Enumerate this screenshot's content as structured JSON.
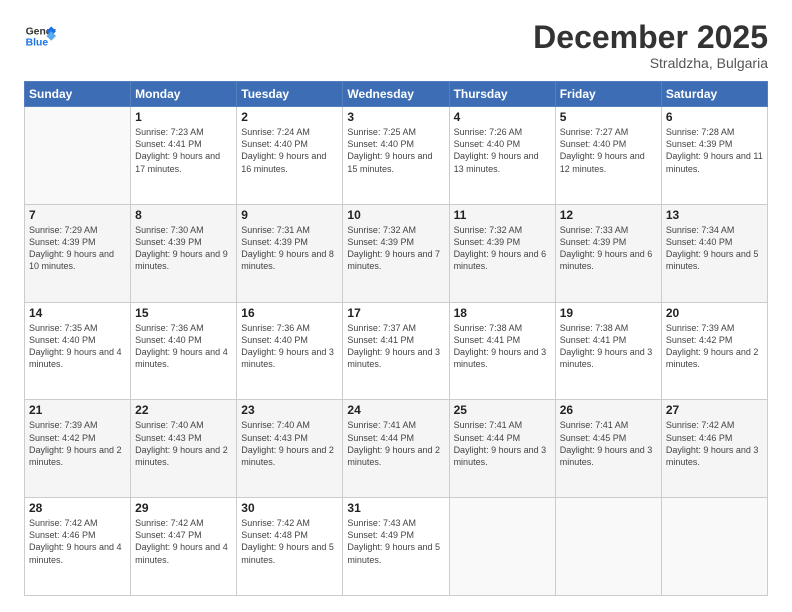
{
  "logo": {
    "line1": "General",
    "line2": "Blue"
  },
  "title": "December 2025",
  "location": "Straldzha, Bulgaria",
  "headers": [
    "Sunday",
    "Monday",
    "Tuesday",
    "Wednesday",
    "Thursday",
    "Friday",
    "Saturday"
  ],
  "weeks": [
    [
      {
        "day": "",
        "sunrise": "",
        "sunset": "",
        "daylight": ""
      },
      {
        "day": "1",
        "sunrise": "Sunrise: 7:23 AM",
        "sunset": "Sunset: 4:41 PM",
        "daylight": "Daylight: 9 hours and 17 minutes."
      },
      {
        "day": "2",
        "sunrise": "Sunrise: 7:24 AM",
        "sunset": "Sunset: 4:40 PM",
        "daylight": "Daylight: 9 hours and 16 minutes."
      },
      {
        "day": "3",
        "sunrise": "Sunrise: 7:25 AM",
        "sunset": "Sunset: 4:40 PM",
        "daylight": "Daylight: 9 hours and 15 minutes."
      },
      {
        "day": "4",
        "sunrise": "Sunrise: 7:26 AM",
        "sunset": "Sunset: 4:40 PM",
        "daylight": "Daylight: 9 hours and 13 minutes."
      },
      {
        "day": "5",
        "sunrise": "Sunrise: 7:27 AM",
        "sunset": "Sunset: 4:40 PM",
        "daylight": "Daylight: 9 hours and 12 minutes."
      },
      {
        "day": "6",
        "sunrise": "Sunrise: 7:28 AM",
        "sunset": "Sunset: 4:39 PM",
        "daylight": "Daylight: 9 hours and 11 minutes."
      }
    ],
    [
      {
        "day": "7",
        "sunrise": "Sunrise: 7:29 AM",
        "sunset": "Sunset: 4:39 PM",
        "daylight": "Daylight: 9 hours and 10 minutes."
      },
      {
        "day": "8",
        "sunrise": "Sunrise: 7:30 AM",
        "sunset": "Sunset: 4:39 PM",
        "daylight": "Daylight: 9 hours and 9 minutes."
      },
      {
        "day": "9",
        "sunrise": "Sunrise: 7:31 AM",
        "sunset": "Sunset: 4:39 PM",
        "daylight": "Daylight: 9 hours and 8 minutes."
      },
      {
        "day": "10",
        "sunrise": "Sunrise: 7:32 AM",
        "sunset": "Sunset: 4:39 PM",
        "daylight": "Daylight: 9 hours and 7 minutes."
      },
      {
        "day": "11",
        "sunrise": "Sunrise: 7:32 AM",
        "sunset": "Sunset: 4:39 PM",
        "daylight": "Daylight: 9 hours and 6 minutes."
      },
      {
        "day": "12",
        "sunrise": "Sunrise: 7:33 AM",
        "sunset": "Sunset: 4:39 PM",
        "daylight": "Daylight: 9 hours and 6 minutes."
      },
      {
        "day": "13",
        "sunrise": "Sunrise: 7:34 AM",
        "sunset": "Sunset: 4:40 PM",
        "daylight": "Daylight: 9 hours and 5 minutes."
      }
    ],
    [
      {
        "day": "14",
        "sunrise": "Sunrise: 7:35 AM",
        "sunset": "Sunset: 4:40 PM",
        "daylight": "Daylight: 9 hours and 4 minutes."
      },
      {
        "day": "15",
        "sunrise": "Sunrise: 7:36 AM",
        "sunset": "Sunset: 4:40 PM",
        "daylight": "Daylight: 9 hours and 4 minutes."
      },
      {
        "day": "16",
        "sunrise": "Sunrise: 7:36 AM",
        "sunset": "Sunset: 4:40 PM",
        "daylight": "Daylight: 9 hours and 3 minutes."
      },
      {
        "day": "17",
        "sunrise": "Sunrise: 7:37 AM",
        "sunset": "Sunset: 4:41 PM",
        "daylight": "Daylight: 9 hours and 3 minutes."
      },
      {
        "day": "18",
        "sunrise": "Sunrise: 7:38 AM",
        "sunset": "Sunset: 4:41 PM",
        "daylight": "Daylight: 9 hours and 3 minutes."
      },
      {
        "day": "19",
        "sunrise": "Sunrise: 7:38 AM",
        "sunset": "Sunset: 4:41 PM",
        "daylight": "Daylight: 9 hours and 3 minutes."
      },
      {
        "day": "20",
        "sunrise": "Sunrise: 7:39 AM",
        "sunset": "Sunset: 4:42 PM",
        "daylight": "Daylight: 9 hours and 2 minutes."
      }
    ],
    [
      {
        "day": "21",
        "sunrise": "Sunrise: 7:39 AM",
        "sunset": "Sunset: 4:42 PM",
        "daylight": "Daylight: 9 hours and 2 minutes."
      },
      {
        "day": "22",
        "sunrise": "Sunrise: 7:40 AM",
        "sunset": "Sunset: 4:43 PM",
        "daylight": "Daylight: 9 hours and 2 minutes."
      },
      {
        "day": "23",
        "sunrise": "Sunrise: 7:40 AM",
        "sunset": "Sunset: 4:43 PM",
        "daylight": "Daylight: 9 hours and 2 minutes."
      },
      {
        "day": "24",
        "sunrise": "Sunrise: 7:41 AM",
        "sunset": "Sunset: 4:44 PM",
        "daylight": "Daylight: 9 hours and 2 minutes."
      },
      {
        "day": "25",
        "sunrise": "Sunrise: 7:41 AM",
        "sunset": "Sunset: 4:44 PM",
        "daylight": "Daylight: 9 hours and 3 minutes."
      },
      {
        "day": "26",
        "sunrise": "Sunrise: 7:41 AM",
        "sunset": "Sunset: 4:45 PM",
        "daylight": "Daylight: 9 hours and 3 minutes."
      },
      {
        "day": "27",
        "sunrise": "Sunrise: 7:42 AM",
        "sunset": "Sunset: 4:46 PM",
        "daylight": "Daylight: 9 hours and 3 minutes."
      }
    ],
    [
      {
        "day": "28",
        "sunrise": "Sunrise: 7:42 AM",
        "sunset": "Sunset: 4:46 PM",
        "daylight": "Daylight: 9 hours and 4 minutes."
      },
      {
        "day": "29",
        "sunrise": "Sunrise: 7:42 AM",
        "sunset": "Sunset: 4:47 PM",
        "daylight": "Daylight: 9 hours and 4 minutes."
      },
      {
        "day": "30",
        "sunrise": "Sunrise: 7:42 AM",
        "sunset": "Sunset: 4:48 PM",
        "daylight": "Daylight: 9 hours and 5 minutes."
      },
      {
        "day": "31",
        "sunrise": "Sunrise: 7:43 AM",
        "sunset": "Sunset: 4:49 PM",
        "daylight": "Daylight: 9 hours and 5 minutes."
      },
      {
        "day": "",
        "sunrise": "",
        "sunset": "",
        "daylight": ""
      },
      {
        "day": "",
        "sunrise": "",
        "sunset": "",
        "daylight": ""
      },
      {
        "day": "",
        "sunrise": "",
        "sunset": "",
        "daylight": ""
      }
    ]
  ]
}
